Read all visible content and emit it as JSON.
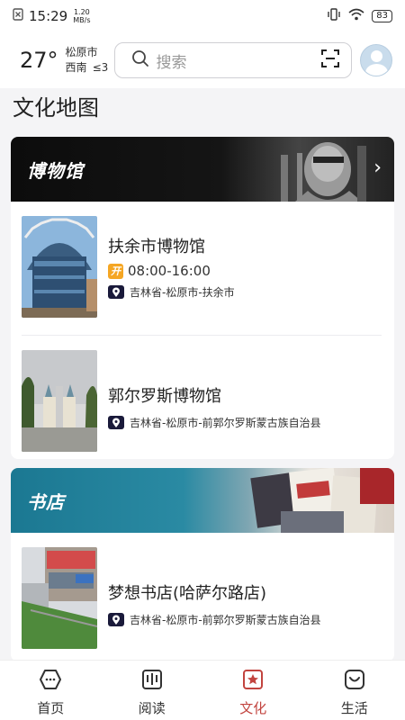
{
  "status_bar": {
    "time": "15:29",
    "net_speed_value": "1.20",
    "net_speed_unit": "MB/s",
    "battery": "83"
  },
  "header": {
    "temperature": "27°",
    "city": "松原市",
    "wind_direction": "西南",
    "wind_level": "≤3",
    "search_placeholder": "搜索"
  },
  "page_title": "文化地图",
  "museum_section": {
    "title": "博物馆",
    "items": [
      {
        "name": "扶余市博物馆",
        "hours": "08:00-16:00",
        "open_badge": "开",
        "address": "吉林省-松原市-扶余市"
      },
      {
        "name": "郭尔罗斯博物馆",
        "address": "吉林省-松原市-前郭尔罗斯蒙古族自治县"
      }
    ]
  },
  "bookstore_section": {
    "title": "书店",
    "items": [
      {
        "name": "梦想书店(哈萨尔路店)",
        "address": "吉林省-松原市-前郭尔罗斯蒙古族自治县"
      }
    ]
  },
  "bottom_nav": [
    {
      "label": "首页",
      "icon": "home-icon",
      "active": false
    },
    {
      "label": "阅读",
      "icon": "book-icon",
      "active": false
    },
    {
      "label": "文化",
      "icon": "culture-icon",
      "active": true
    },
    {
      "label": "生活",
      "icon": "life-icon",
      "active": false
    }
  ],
  "colors": {
    "accent": "#c2443f",
    "teal": "#1b7892",
    "open_badge": "#f5a623"
  }
}
